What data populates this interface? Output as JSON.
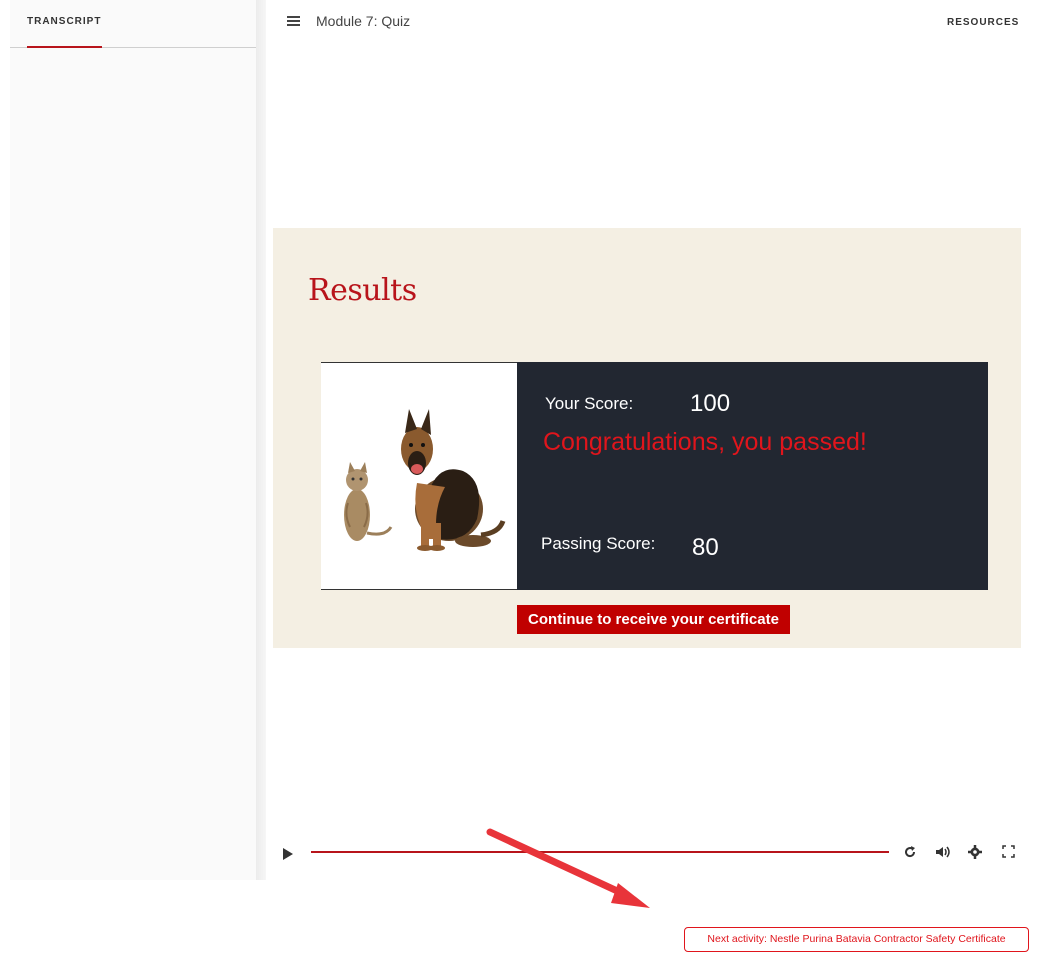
{
  "sidebar": {
    "tab_label": "TRANSCRIPT"
  },
  "header": {
    "title": "Module 7: Quiz",
    "resources_label": "RESOURCES"
  },
  "slide": {
    "title": "Results",
    "score_label": "Your Score:",
    "score_value": "100",
    "congrats_message": "Congratulations, you passed!",
    "passing_label": "Passing Score:",
    "passing_value": "80",
    "continue_label": "Continue to receive your certificate"
  },
  "player": {
    "icons": [
      "play-icon",
      "replay-icon",
      "volume-icon",
      "gear-icon",
      "fullscreen-icon"
    ],
    "accent_color": "#b8141b"
  },
  "next_activity": {
    "label": "Next activity: Nestle Purina Batavia Contractor Safety Certificate"
  },
  "colors": {
    "accent": "#b8141b",
    "slide_bg": "#f4efe3",
    "card_bg": "#222731",
    "congrats": "#e0151c",
    "button_bg": "#c00000"
  }
}
